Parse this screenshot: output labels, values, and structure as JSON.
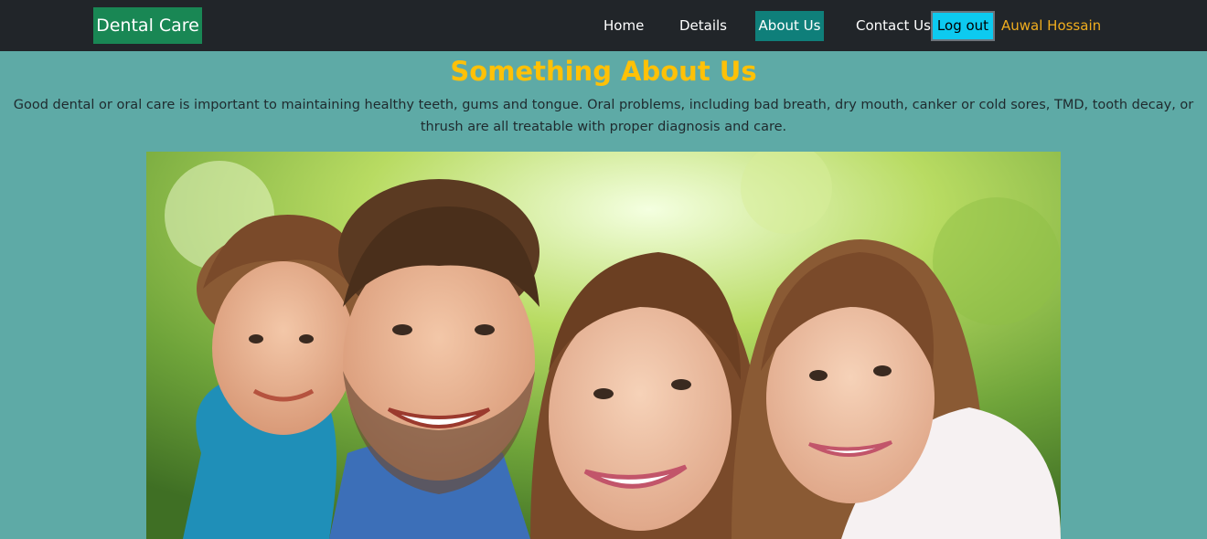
{
  "navbar": {
    "brand": "Dental Care",
    "links": [
      "Home",
      "Details",
      "About Us",
      "Contact Us"
    ],
    "active": "About Us",
    "logout_label": "Log out",
    "user_name": "Auwal Hossain"
  },
  "about": {
    "title": "Something About Us",
    "description": "Good dental or oral care is important to maintaining healthy teeth, gums and tongue. Oral problems, including bad breath, dry mouth, canker or cold sores, TMD, tooth decay, or thrush are all treatable with proper diagnosis and care."
  },
  "hero_image": {
    "subject": "smiling-family-photo"
  },
  "colors": {
    "page_bg": "#5eaaa6",
    "navbar_bg": "#212529",
    "brand_bg": "#198754",
    "active_bg": "#0f7f7a",
    "logout_bg": "#0dcaf0",
    "user_color": "#f0ad1e",
    "title_color": "#ffc107"
  }
}
